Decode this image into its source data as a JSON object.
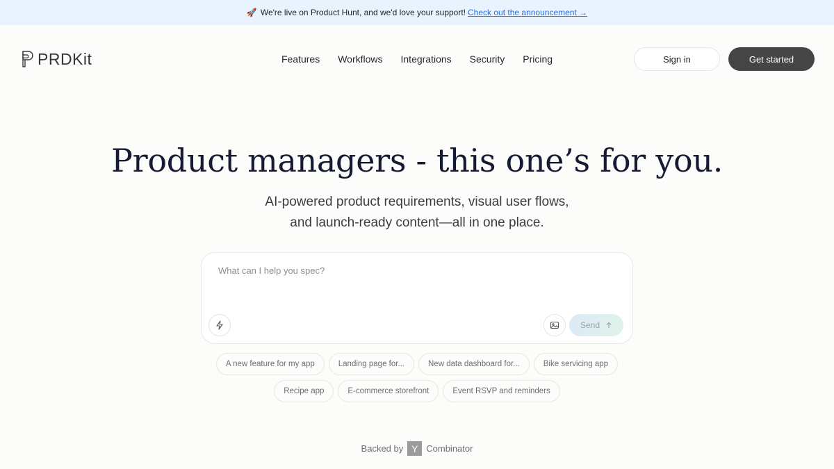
{
  "announcement": {
    "emoji": "🚀",
    "text": "We're live on Product Hunt, and we'd love your support!",
    "link": "Check out the announcement →"
  },
  "header": {
    "brand": "PRDKit",
    "nav": [
      "Features",
      "Workflows",
      "Integrations",
      "Security",
      "Pricing"
    ],
    "sign_in": "Sign in",
    "get_started": "Get started"
  },
  "hero": {
    "title": "Product managers - this one’s for you.",
    "subtitle_line1": "AI-powered product requirements, visual user flows,",
    "subtitle_line2": "and launch-ready content—all in one place."
  },
  "prompt": {
    "placeholder": "What can I help you spec?",
    "value": "",
    "send_label": "Send",
    "icons": [
      "bolt-icon",
      "image-icon",
      "arrow-up-icon"
    ]
  },
  "suggestions": {
    "row1": [
      "A new feature for my app",
      "Landing page for...",
      "New data dashboard for...",
      "Bike servicing app"
    ],
    "row2": [
      "Recipe app",
      "E-commerce storefront",
      "Event RSVP and reminders"
    ]
  },
  "backed": {
    "prefix": "Backed by",
    "badge": "Y",
    "suffix": "Combinator"
  },
  "colors": {
    "background": "#fcfcfa",
    "announcement_bg": "#e8f3fd",
    "link": "#2f6fdd",
    "primary_button": "#454545",
    "title": "#161b33"
  }
}
